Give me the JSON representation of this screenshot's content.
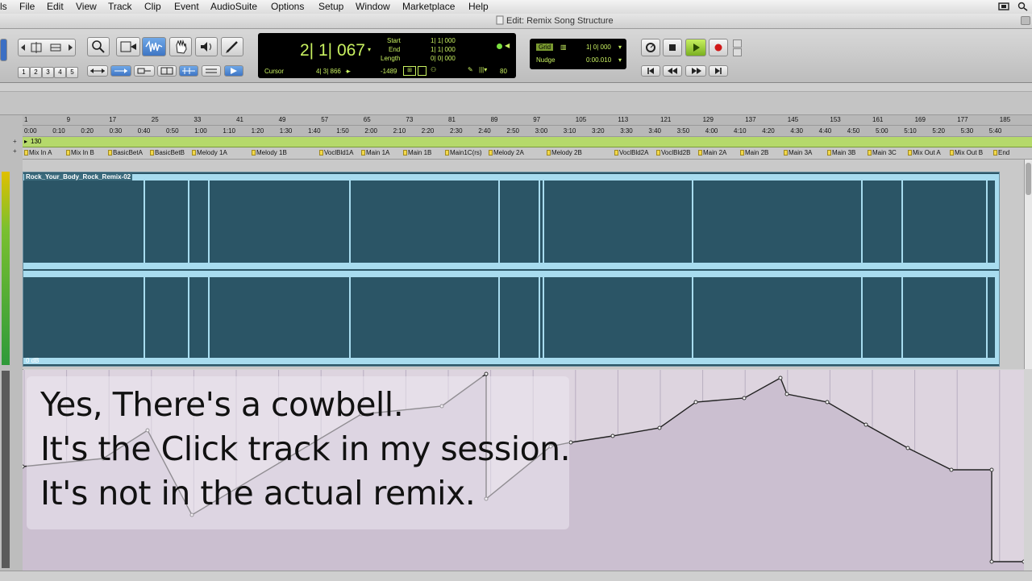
{
  "menubar": {
    "app_label": "ls",
    "items": [
      "File",
      "Edit",
      "View",
      "Track",
      "Clip",
      "Event",
      "AudioSuite",
      "Options",
      "Setup",
      "Window",
      "Marketplace",
      "Help"
    ]
  },
  "window": {
    "title": "Edit: Remix Song Structure"
  },
  "toolbar": {
    "zoom_presets": [
      "1",
      "2",
      "3",
      "4",
      "5"
    ]
  },
  "counter": {
    "main": "2| 1| 067",
    "start_label": "Start",
    "end_label": "End",
    "length_label": "Length",
    "start_value": "1| 1| 000",
    "end_value": "1| 1| 000",
    "length_value": "0| 0| 000",
    "cursor_label": "Cursor",
    "cursor_value": "4| 3| 866",
    "cursor_extra": "-1489",
    "tempo": "80"
  },
  "grid": {
    "grid_label": "Grid",
    "grid_value": "1| 0| 000",
    "nudge_label": "Nudge",
    "nudge_value": "0:00.010"
  },
  "ruler": {
    "bars": [
      "1",
      "9",
      "17",
      "25",
      "33",
      "41",
      "49",
      "57",
      "65",
      "73",
      "81",
      "89",
      "97",
      "105",
      "113",
      "121",
      "129",
      "137",
      "145",
      "153",
      "161",
      "169",
      "177",
      "185"
    ],
    "times": [
      "0:00",
      "0:10",
      "0:20",
      "0:30",
      "0:40",
      "0:50",
      "1:00",
      "1:10",
      "1:20",
      "1:30",
      "1:40",
      "1:50",
      "2:00",
      "2:10",
      "2:20",
      "2:30",
      "2:40",
      "2:50",
      "3:00",
      "3:10",
      "3:20",
      "3:30",
      "3:40",
      "3:50",
      "4:00",
      "4:10",
      "4:20",
      "4:30",
      "4:40",
      "4:50",
      "5:00",
      "5:10",
      "5:20",
      "5:30",
      "5:40"
    ],
    "tempo": "130"
  },
  "markers": [
    "Mix In A",
    "Mix In B",
    "BasicBetA",
    "BasicBetB",
    "Melody 1A",
    "Melody 1B",
    "VoclBld1A",
    "Main 1A",
    "Main 1B",
    "Main1C(rs)",
    "Melody 2A",
    "Melody 2B",
    "VoclBld2A",
    "VoclBld2B",
    "Main 2A",
    "Main 2B",
    "Main 3A",
    "Main 3B",
    "Main 3C",
    "Mix Out A",
    "Mix Out B",
    "End"
  ],
  "clip": {
    "name": "Rock_Your_Body_Rock_Remix-02",
    "gain": "0 dB"
  },
  "caption": {
    "line1": "Yes, There's a cowbell.",
    "line2": "It's the Click track in my session.",
    "line3": "It's not in the actual remix."
  },
  "colors": {
    "waveform_bg": "#2b5566",
    "waveform_fg": "#a8dcef",
    "tempo_track": "#b5d96b",
    "marker": "#f2d84a",
    "automation_fill": "#cbbfd0",
    "counter_text": "#c8f060"
  }
}
